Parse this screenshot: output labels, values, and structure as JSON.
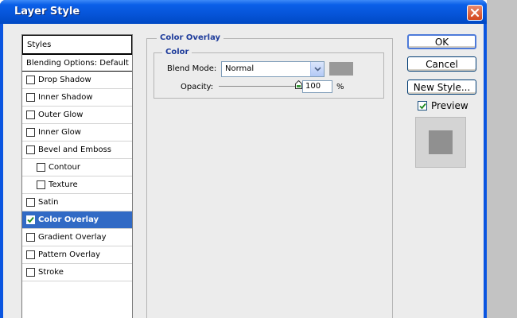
{
  "window": {
    "title": "Layer Style",
    "colors": {
      "titlebar": "#0654d8",
      "selection": "#316ac5",
      "legend": "#1e3c9b",
      "swatch": "#999999"
    }
  },
  "style_list": {
    "header": "Styles",
    "blending": "Blending Options: Default",
    "items": [
      {
        "label": "Drop Shadow",
        "checked": false
      },
      {
        "label": "Inner Shadow",
        "checked": false
      },
      {
        "label": "Outer Glow",
        "checked": false
      },
      {
        "label": "Inner Glow",
        "checked": false
      },
      {
        "label": "Bevel and Emboss",
        "checked": false
      },
      {
        "label": "Contour",
        "checked": false
      },
      {
        "label": "Texture",
        "checked": false
      },
      {
        "label": "Satin",
        "checked": false
      },
      {
        "label": "Color Overlay",
        "checked": true,
        "selected": true
      },
      {
        "label": "Gradient Overlay",
        "checked": false
      },
      {
        "label": "Pattern Overlay",
        "checked": false
      },
      {
        "label": "Stroke",
        "checked": false
      }
    ]
  },
  "color_overlay": {
    "group_title": "Color Overlay",
    "sub_title": "Color",
    "blend_mode_label": "Blend Mode:",
    "blend_mode_value": "Normal",
    "opacity_label": "Opacity:",
    "opacity_value": "100",
    "opacity_unit": "%",
    "opacity_fraction": 1.0
  },
  "buttons": {
    "ok": "OK",
    "cancel": "Cancel",
    "new_style": "New Style..."
  },
  "preview": {
    "label": "Preview",
    "checked": true
  }
}
